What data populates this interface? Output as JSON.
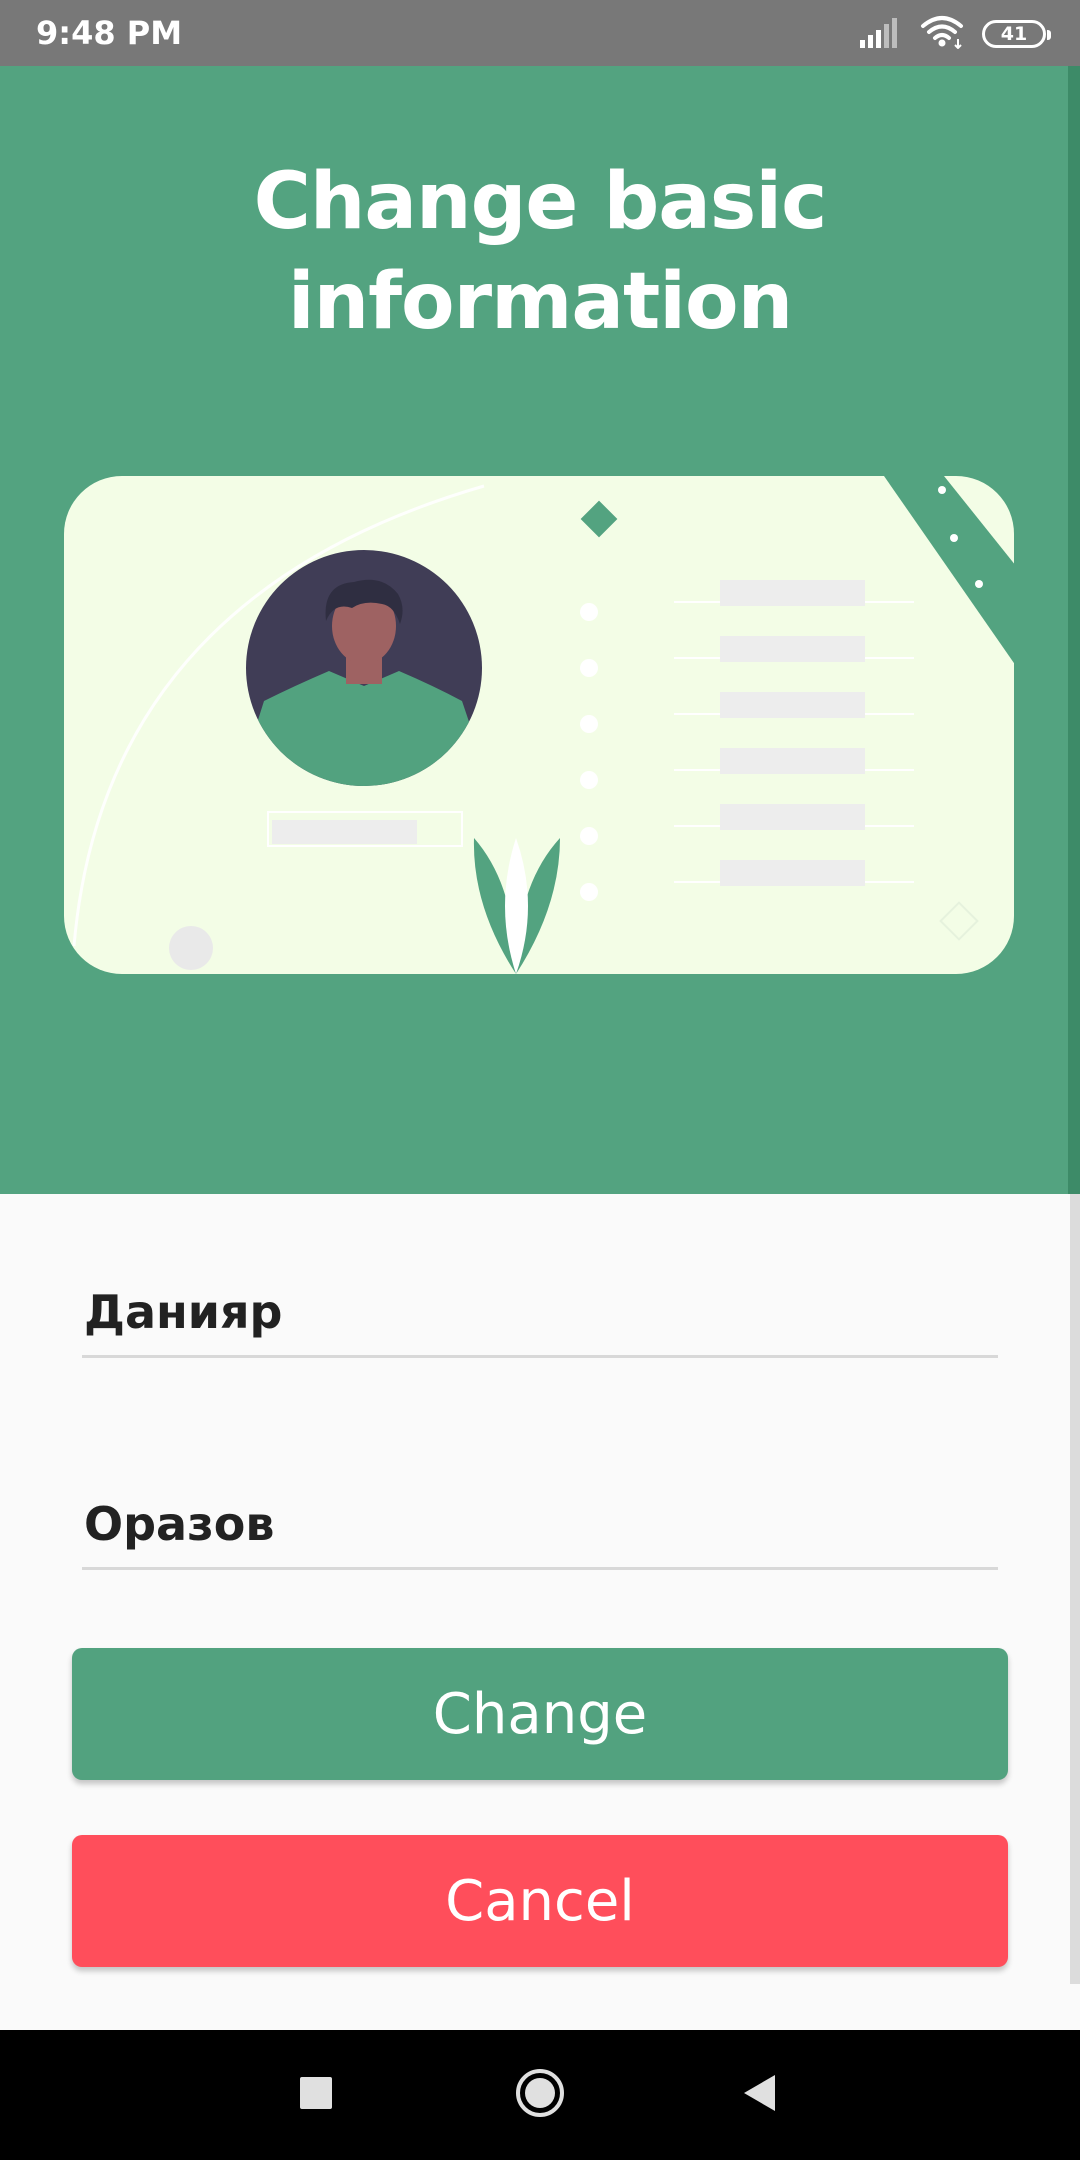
{
  "status_bar": {
    "time": "9:48 PM",
    "battery_level": "41",
    "icons": [
      "signal-icon",
      "wifi-icon",
      "battery-icon"
    ]
  },
  "header": {
    "title": "Change basic information",
    "background_color": "#53a380",
    "illustration": "profile-card-illustration"
  },
  "form": {
    "first_name": "Данияр",
    "last_name": "Оразов"
  },
  "actions": {
    "change_label": "Change",
    "change_color": "#52a27f",
    "cancel_label": "Cancel",
    "cancel_color": "#ff4e5b"
  },
  "nav_bar": {
    "icons": [
      "recents-icon",
      "home-icon",
      "back-icon"
    ]
  }
}
